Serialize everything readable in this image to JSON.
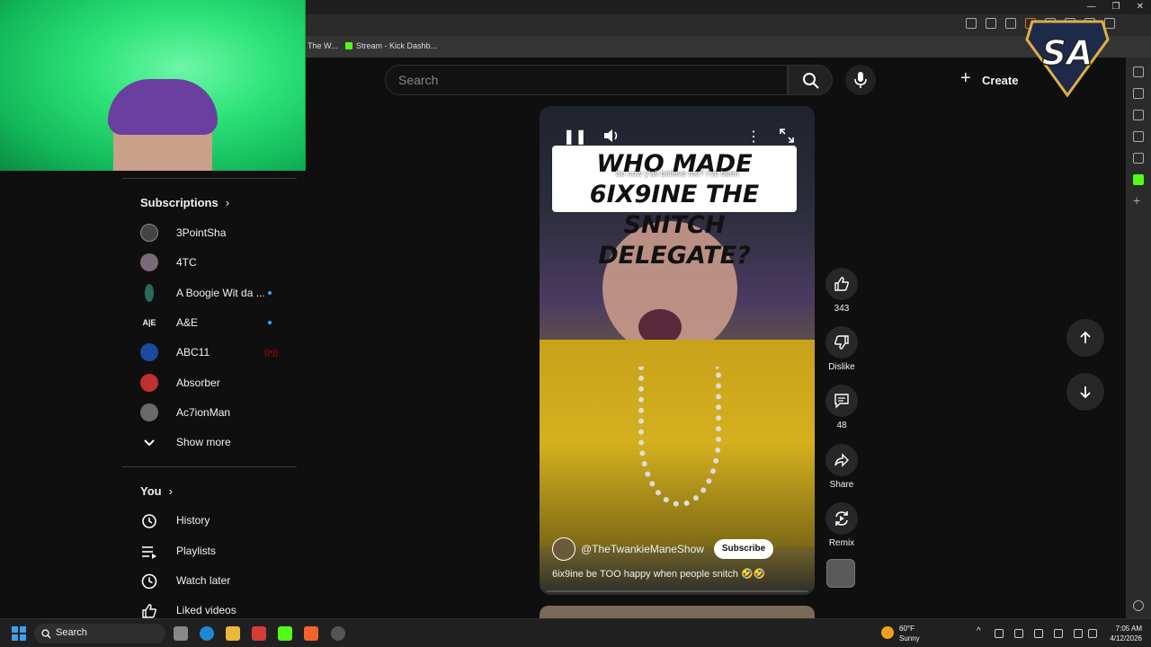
{
  "browser": {
    "bookmarks": [
      {
        "label": "The W..."
      },
      {
        "label": "Stream - Kick Dashb..."
      }
    ]
  },
  "header": {
    "search_placeholder": "Search",
    "create_label": "Create",
    "overlay_logo_text": "SA"
  },
  "sidebar": {
    "subscriptions_title": "Subscriptions",
    "subscriptions": [
      {
        "name": "3PointSha",
        "color": "#444444",
        "indicator": "none"
      },
      {
        "name": "4TC",
        "color": "#7a6a7a",
        "indicator": "none"
      },
      {
        "name": "A Boogie Wit da ...",
        "color": "#2a6a5a",
        "indicator": "new"
      },
      {
        "name": "A&E",
        "color": "#0f0f0f",
        "indicator": "new"
      },
      {
        "name": "ABC11",
        "color": "#1a4aa0",
        "indicator": "live"
      },
      {
        "name": "Absorber",
        "color": "#c03030",
        "indicator": "none"
      },
      {
        "name": "Ac7ionMan",
        "color": "#6a6a6a",
        "indicator": "none"
      }
    ],
    "show_more_label": "Show more",
    "you_title": "You",
    "you_items": [
      {
        "label": "History",
        "icon": "history-icon"
      },
      {
        "label": "Playlists",
        "icon": "playlists-icon"
      },
      {
        "label": "Watch later",
        "icon": "clock-icon"
      },
      {
        "label": "Liked videos",
        "icon": "thumbs-up-icon"
      }
    ]
  },
  "short": {
    "caption_overlay": "WHO MADE 6IX9INE THE SNITCH DELEGATE?",
    "subtitle": "So now y'all believe me? I've been",
    "channel_handle": "@TheTwankieManeShow",
    "subscribe_label": "Subscribe",
    "title": "6ix9ine be TOO happy when people snitch 🤣🤣",
    "progress": 0.0
  },
  "actions": {
    "like_count": "343",
    "dislike_label": "Dislike",
    "comment_count": "48",
    "share_label": "Share",
    "remix_label": "Remix"
  },
  "taskbar": {
    "search_label": "Search",
    "weather_temp": "60°F",
    "weather_desc": "Sunny",
    "time": "7:05 AM",
    "date": "4/12/2026"
  },
  "colors": {
    "page_bg": "#0f0f0f",
    "accent_kick": "#53fc18",
    "webcam_green": "#2fe47a"
  }
}
